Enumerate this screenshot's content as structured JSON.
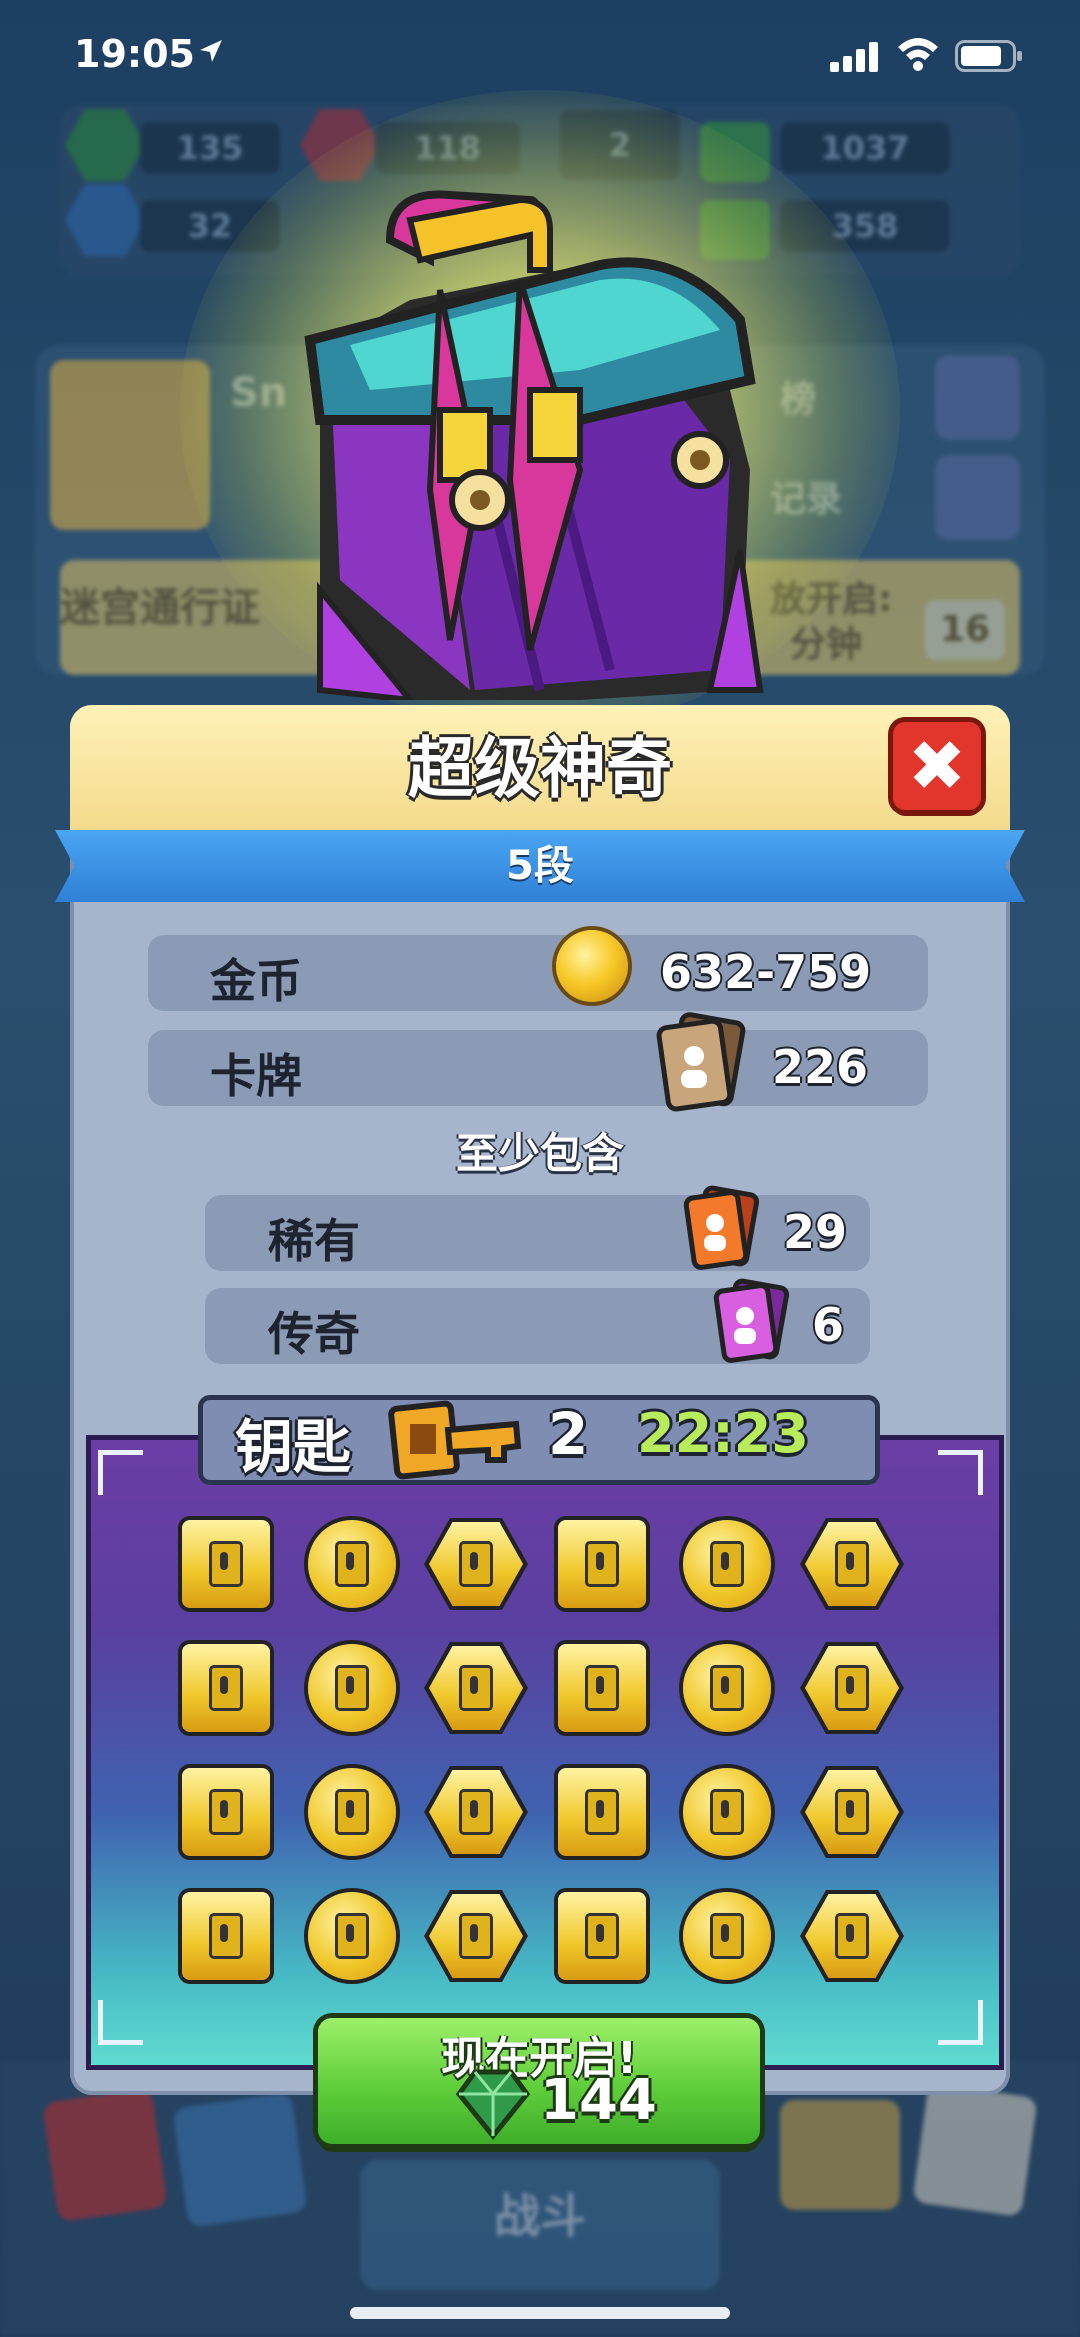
{
  "status_bar": {
    "time": "19:05"
  },
  "background_hud": {
    "resources": [
      "135",
      "118",
      "2",
      "1037",
      "32",
      "358"
    ],
    "player_name_partial": "Sn",
    "rank_partial": "榜",
    "record_partial": "记录",
    "pass_label": "迷宫通行证",
    "open_partial": "放开启:",
    "minutes_partial": "分钟",
    "level_badge": "16",
    "battle_label": "战斗"
  },
  "chest": {
    "title": "超级神奇",
    "tier": "5段",
    "rows": [
      {
        "label": "金币",
        "value": "632-759",
        "icon": "gold-coin-icon"
      },
      {
        "label": "卡牌",
        "value": "226",
        "icon": "card-icon"
      }
    ],
    "at_least_label": "至少包含",
    "guaranteed": [
      {
        "label": "稀有",
        "value": "29",
        "icon": "rare-card-icon"
      },
      {
        "label": "传奇",
        "value": "6",
        "icon": "legendary-card-icon"
      }
    ]
  },
  "keys": {
    "label": "钥匙",
    "count": "2",
    "timer": "22:23",
    "slots": [
      "square",
      "circle",
      "hexagon",
      "square",
      "circle",
      "hexagon"
    ]
  },
  "open_button": {
    "label": "现在开启!",
    "cost": "144",
    "icon": "gem-icon"
  },
  "colors": {
    "accent_green": "#5fce3a",
    "close_red": "#e2352c",
    "banner_blue": "#3a8fe4",
    "timer_green": "#b9ec5a"
  }
}
